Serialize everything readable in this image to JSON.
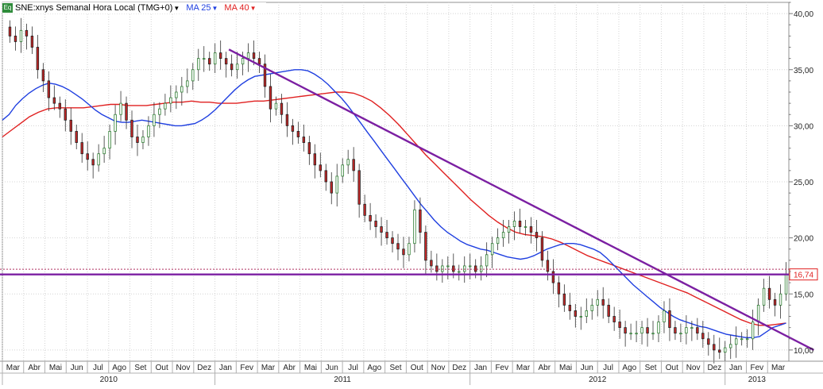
{
  "header": {
    "icon_label": "Eq",
    "symbol": "SNE:xnys Semanal Hora Local (TMG+0)",
    "ma_short": "MA 25",
    "ma_long": "MA 40"
  },
  "colors": {
    "ma_short": "#1f3fe0",
    "ma_long": "#e02020",
    "trendline": "#7b1fa2",
    "price_line": "#7b1fa2",
    "candle_up": "#2e7d32",
    "candle_down": "#c62828",
    "grid": "#d4d4d4",
    "last_price_label": "#e02020"
  },
  "chart_data": {
    "type": "candlestick",
    "x_unit": "week",
    "ylim": [
      9,
      41
    ],
    "y_ticks": [
      "10,00",
      "15,00",
      "20,00",
      "25,00",
      "30,00",
      "35,00",
      "40,00"
    ],
    "y_tick_values": [
      10,
      15,
      20,
      25,
      30,
      35,
      40
    ],
    "months": [
      "Mar",
      "Abr",
      "Mai",
      "Jun",
      "Jul",
      "Ago",
      "Set",
      "Out",
      "Nov",
      "Dez",
      "Jan",
      "Fev",
      "Mar",
      "Abr",
      "Mai",
      "Jun",
      "Jul",
      "Ago",
      "Set",
      "Out",
      "Nov",
      "Dez",
      "Jan",
      "Fev",
      "Mar",
      "Abr",
      "Mai",
      "Jun",
      "Jul",
      "Ago",
      "Set",
      "Out",
      "Nov",
      "Dez",
      "Jan",
      "Fev",
      "Mar"
    ],
    "years": [
      {
        "label": "2010",
        "start_month": 0,
        "end_month": 10
      },
      {
        "label": "2011",
        "start_month": 10,
        "end_month": 22
      },
      {
        "label": "2012",
        "start_month": 22,
        "end_month": 34
      },
      {
        "label": "2013",
        "start_month": 34,
        "end_month": 37
      }
    ],
    "close": [
      38.0,
      37.5,
      38.5,
      38.0,
      37.0,
      35.0,
      34.0,
      32.5,
      32.0,
      31.5,
      30.5,
      29.5,
      28.5,
      27.5,
      27.0,
      26.5,
      27.5,
      28.0,
      29.5,
      31.0,
      32.0,
      30.5,
      29.0,
      28.5,
      29.0,
      30.0,
      31.0,
      31.5,
      32.0,
      32.5,
      33.0,
      33.5,
      34.0,
      35.0,
      36.0,
      36.0,
      35.5,
      36.5,
      36.0,
      35.5,
      35.0,
      35.5,
      36.0,
      36.5,
      36.0,
      35.5,
      33.5,
      31.5,
      32.0,
      31.0,
      30.0,
      29.5,
      29.0,
      28.5,
      27.5,
      26.5,
      26.0,
      25.0,
      24.0,
      25.5,
      26.5,
      27.0,
      26.0,
      23.0,
      22.0,
      21.5,
      21.0,
      20.5,
      20.0,
      19.5,
      19.0,
      18.5,
      19.5,
      22.5,
      20.5,
      18.0,
      17.5,
      17.0,
      17.5,
      17.5,
      17.0,
      17.0,
      17.5,
      17.5,
      17.0,
      17.5,
      18.5,
      19.5,
      20.0,
      20.5,
      21.0,
      21.5,
      21.0,
      21.0,
      20.5,
      20.0,
      18.0,
      17.0,
      16.0,
      15.0,
      14.0,
      13.5,
      13.0,
      13.0,
      13.5,
      14.0,
      14.5,
      14.0,
      13.0,
      12.5,
      12.0,
      11.5,
      11.5,
      11.5,
      12.0,
      11.5,
      11.5,
      12.5,
      13.5,
      12.0,
      11.5,
      11.5,
      12.0,
      12.0,
      11.5,
      11.0,
      10.5,
      10.0,
      9.8,
      10.2,
      10.5,
      11.0,
      11.0,
      11.0,
      12.5,
      14.0,
      15.5,
      14.5,
      14.0,
      15.0,
      16.74
    ],
    "ma_short_values": [
      30.5,
      31.0,
      31.8,
      32.4,
      32.9,
      33.3,
      33.6,
      33.8,
      33.7,
      33.5,
      33.2,
      32.8,
      32.4,
      31.9,
      31.4,
      31.0,
      30.7,
      30.4,
      30.3,
      30.3,
      30.4,
      30.5,
      30.4,
      30.3,
      30.2,
      30.1,
      30.0,
      30.0,
      30.1,
      30.2,
      30.5,
      30.9,
      31.4,
      32.0,
      32.6,
      33.2,
      33.7,
      34.1,
      34.4,
      34.5,
      34.6,
      34.7,
      34.8,
      34.9,
      35.0,
      35.0,
      34.9,
      34.6,
      34.2,
      33.7,
      33.1,
      32.5,
      31.8,
      31.0,
      30.2,
      29.4,
      28.6,
      27.8,
      27.0,
      26.2,
      25.4,
      24.6,
      23.8,
      23.0,
      22.3,
      21.6,
      21.0,
      20.5,
      20.1,
      19.7,
      19.4,
      19.2,
      19.0,
      18.9,
      18.7,
      18.5,
      18.3,
      18.2,
      18.1,
      18.2,
      18.4,
      18.7,
      19.0,
      19.2,
      19.4,
      19.5,
      19.5,
      19.4,
      19.2,
      19.0,
      18.7,
      18.2,
      17.6,
      17.0,
      16.4,
      15.8,
      15.3,
      14.8,
      14.3,
      13.8,
      13.4,
      13.0,
      12.7,
      12.5,
      12.3,
      12.1,
      12.0,
      11.8,
      11.6,
      11.4,
      11.3,
      11.2,
      11.1,
      11.1,
      11.2,
      11.6,
      12.0,
      12.2,
      12.4
    ],
    "ma_long_values": [
      29.0,
      29.6,
      30.2,
      30.8,
      31.2,
      31.5,
      31.6,
      31.6,
      31.6,
      31.6,
      31.7,
      31.8,
      31.9,
      31.9,
      31.8,
      31.8,
      31.8,
      31.9,
      32.0,
      32.1,
      32.1,
      32.2,
      32.1,
      32.1,
      32.0,
      32.0,
      32.0,
      32.1,
      32.2,
      32.2,
      32.3,
      32.4,
      32.5,
      32.6,
      32.7,
      32.8,
      32.9,
      33.0,
      33.0,
      32.9,
      32.6,
      32.2,
      31.6,
      30.9,
      30.1,
      29.2,
      28.3,
      27.4,
      26.6,
      25.8,
      25.0,
      24.2,
      23.4,
      22.7,
      22.0,
      21.4,
      20.9,
      20.5,
      20.3,
      20.2,
      20.1,
      19.9,
      19.6,
      19.2,
      18.8,
      18.4,
      18.1,
      17.8,
      17.5,
      17.2,
      16.9,
      16.6,
      16.3,
      16.0,
      15.7,
      15.4,
      15.1,
      14.7,
      14.3,
      13.9,
      13.5,
      13.1,
      12.7,
      12.4,
      12.2,
      12.2,
      12.3,
      12.4
    ],
    "trendline": {
      "start": {
        "week": 39.5,
        "value": 36.8
      },
      "end": {
        "week": 145,
        "value": 10.0
      }
    },
    "price_line_value": 16.74,
    "last_price_label": "16,74",
    "dotted_line_value": 17.2
  }
}
